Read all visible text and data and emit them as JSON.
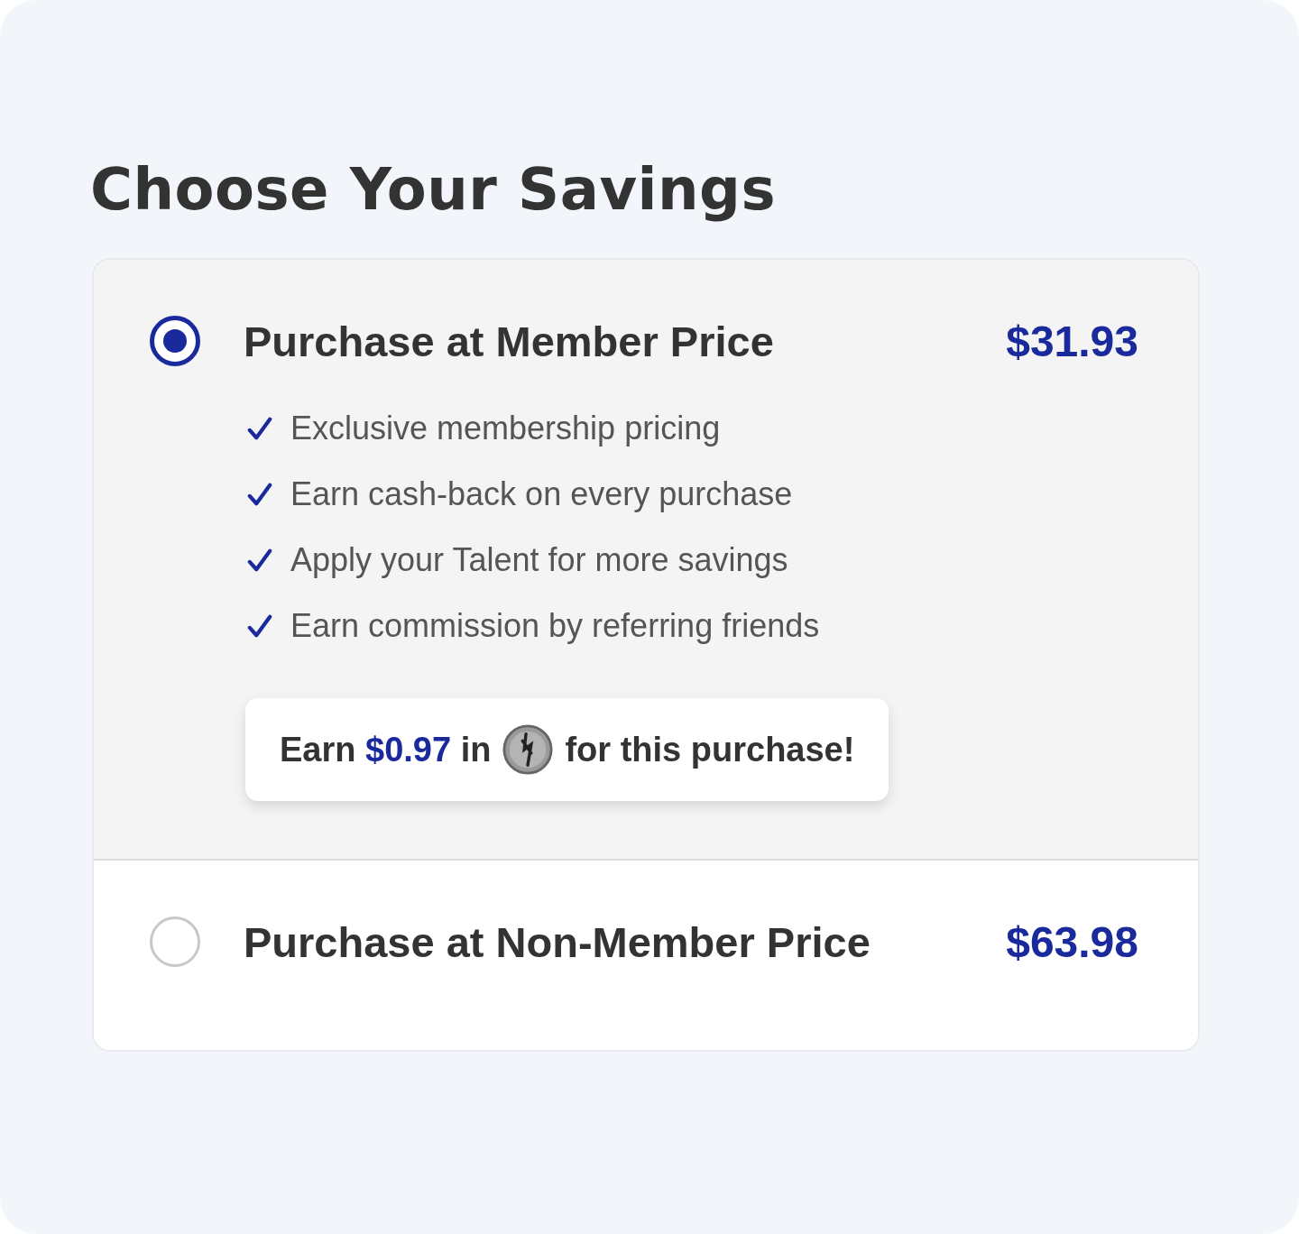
{
  "heading": "Choose Your Savings",
  "options": [
    {
      "title": "Purchase at Member Price",
      "price": "$31.93",
      "selected": true,
      "features": [
        "Exclusive membership pricing",
        "Earn cash-back on every purchase",
        "Apply your Talent for more savings",
        "Earn commission by referring friends"
      ],
      "reward": {
        "before": "Earn",
        "amount": "$0.97",
        "after": "in",
        "suffix": "for this purchase!"
      }
    },
    {
      "title": "Purchase at Non-Member Price",
      "price": "$63.98",
      "selected": false
    }
  ]
}
